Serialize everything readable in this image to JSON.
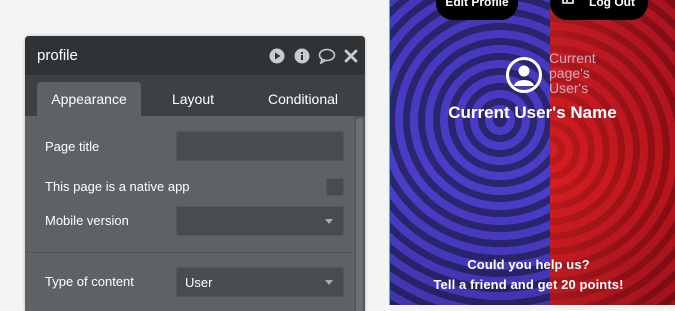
{
  "editor": {
    "title": "profile",
    "header_icons": [
      "play-icon",
      "info-icon",
      "comment-icon",
      "close-icon"
    ],
    "tabs": [
      {
        "label": "Appearance",
        "active": true
      },
      {
        "label": "Layout",
        "active": false
      },
      {
        "label": "Conditional",
        "active": false
      }
    ],
    "fields": {
      "page_title_label": "Page title",
      "page_title_value": "",
      "native_app_label": "This page is a native app",
      "native_app_checked": false,
      "mobile_version_label": "Mobile version",
      "mobile_version_value": "",
      "type_of_content_label": "Type of content",
      "type_of_content_value": "User"
    }
  },
  "preview": {
    "edit_profile_button": "Edit Profile",
    "log_out_button": "Log Out",
    "avatar_alt_text": "Current page's User's",
    "user_name": "Current User's Name",
    "help_line1": "Could you help us?",
    "help_line2": "Tell a friend and get 20 points!"
  },
  "colors": {
    "panel_header": "#2f3336",
    "panel_body": "#5e6265",
    "tab_bar": "#3d4144",
    "field_bg": "#494c4f",
    "preview_blue": "#4a3dc9",
    "preview_red": "#c4161e",
    "preview_border": "#59b3c4"
  }
}
